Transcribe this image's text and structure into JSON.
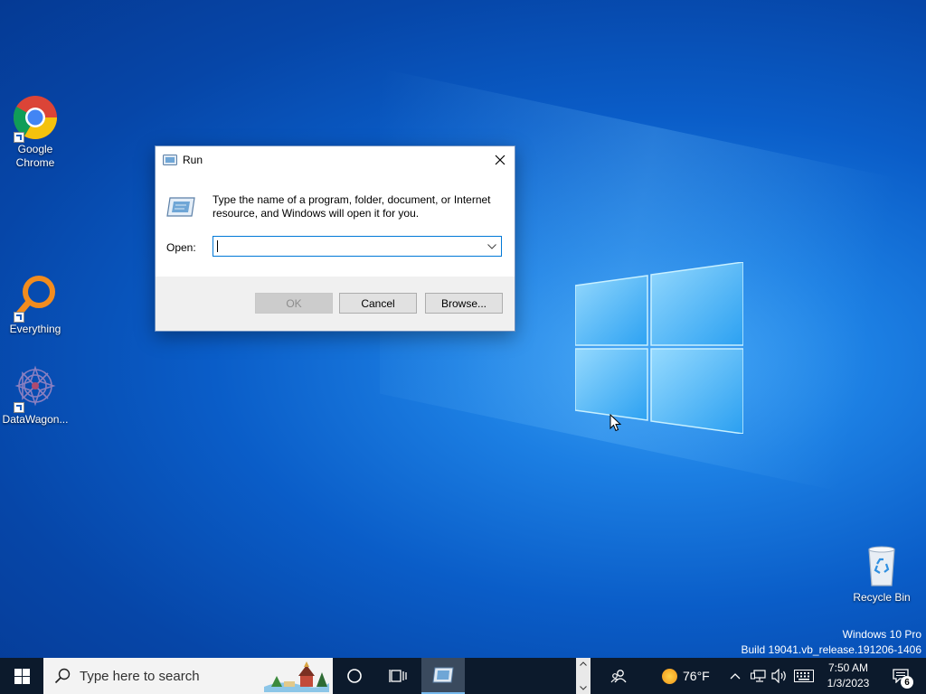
{
  "desktop": {
    "icons": [
      {
        "label": "Google Chrome",
        "icon": "chrome-icon"
      },
      {
        "label": "Everything",
        "icon": "everything-search-icon"
      },
      {
        "label": "DataWagon...",
        "icon": "datawagon-icon"
      },
      {
        "label": "Recycle Bin",
        "icon": "recycle-bin-icon"
      }
    ],
    "watermark": {
      "line1": "Windows 10 Pro",
      "line2": "Build 19041.vb_release.191206-1406"
    }
  },
  "run_dialog": {
    "title": "Run",
    "description": "Type the name of a program, folder, document, or Internet resource, and Windows will open it for you.",
    "open_label": "Open:",
    "open_value": "",
    "buttons": {
      "ok": "OK",
      "cancel": "Cancel",
      "browse": "Browse..."
    },
    "ok_disabled": true
  },
  "taskbar": {
    "search_placeholder": "Type here to search",
    "weather": {
      "temperature": "76°F",
      "icon": "sun-icon"
    },
    "clock": {
      "time": "7:50 AM",
      "date": "1/3/2023"
    },
    "notification_count": "6"
  },
  "colors": {
    "accent": "#0078d7",
    "taskbar": "#0c1a2c",
    "desktop": "#0a5dc8"
  }
}
